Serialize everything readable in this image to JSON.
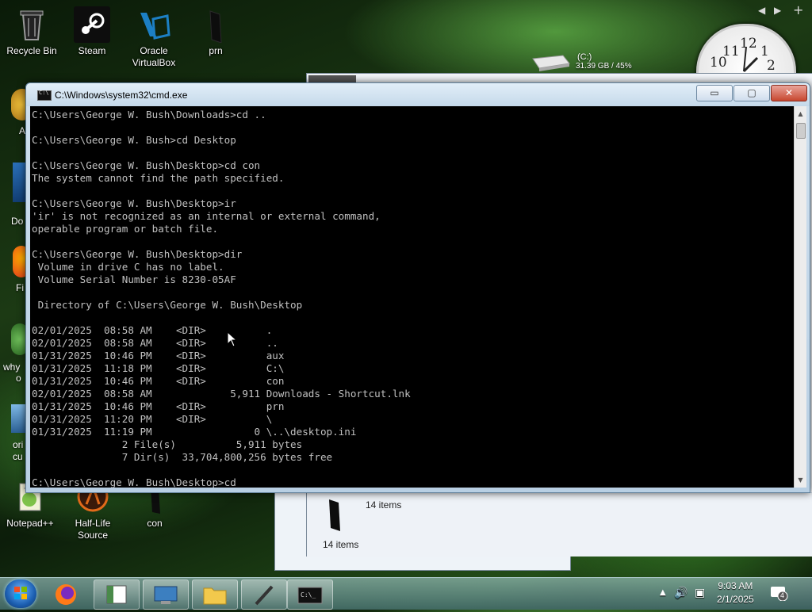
{
  "desktop": {
    "icons": [
      {
        "label": "Recycle Bin",
        "icon": "recycle-bin-icon"
      },
      {
        "label": "Steam",
        "icon": "steam-icon"
      },
      {
        "label": "Oracle\nVirtualBox",
        "icon": "virtualbox-icon"
      },
      {
        "label": "prn",
        "icon": "folder-icon"
      },
      {
        "label": "Notepad++",
        "icon": "notepadpp-icon"
      },
      {
        "label": "Half-Life\nSource",
        "icon": "halflife-icon"
      },
      {
        "label": "con",
        "icon": "folder-icon"
      }
    ],
    "partial_labels": [
      "A",
      "Do",
      "Fi",
      "why",
      "o",
      "ori",
      "cu"
    ]
  },
  "drive_gadget": {
    "drive": "(C:)",
    "usage": "31.39 GB / 45%"
  },
  "clock_gadget": {
    "numerals": [
      "11",
      "12",
      "1",
      "10",
      "2"
    ]
  },
  "background_windows": {
    "status_1": "14 items",
    "status_2": "14 items"
  },
  "cmd_window": {
    "title": "C:\\Windows\\system32\\cmd.exe",
    "buttons": {
      "minimize": "▭",
      "maximize": "▢",
      "close": "✕"
    },
    "console_text": "C:\\Users\\George W. Bush\\Downloads>cd ..\n\nC:\\Users\\George W. Bush>cd Desktop\n\nC:\\Users\\George W. Bush\\Desktop>cd con\nThe system cannot find the path specified.\n\nC:\\Users\\George W. Bush\\Desktop>ir\n'ir' is not recognized as an internal or external command,\noperable program or batch file.\n\nC:\\Users\\George W. Bush\\Desktop>dir\n Volume in drive C has no label.\n Volume Serial Number is 8230-05AF\n\n Directory of C:\\Users\\George W. Bush\\Desktop\n\n02/01/2025  08:58 AM    <DIR>          .\n02/01/2025  08:58 AM    <DIR>          ..\n01/31/2025  10:46 PM    <DIR>          aux\n01/31/2025  11:18 PM    <DIR>          C:\\\n01/31/2025  10:46 PM    <DIR>          con\n02/01/2025  08:58 AM             5,911 Downloads - Shortcut.lnk\n01/31/2025  10:46 PM    <DIR>          prn\n01/31/2025  11:20 PM    <DIR>          \\\n01/31/2025  11:19 PM                 0 \\..\\desktop.ini\n               2 File(s)          5,911 bytes\n               7 Dir(s)  33,704,800,256 bytes free\n\nC:\\Users\\George W. Bush\\Desktop>cd"
  },
  "taskbar": {
    "items": [
      "firefox-icon",
      "explorer-window-icon",
      "control-panel-icon",
      "file-explorer-icon",
      "notepad-icon",
      "cmd-icon"
    ],
    "tray": {
      "time": "9:03 AM",
      "date": "2/1/2025",
      "notification_count": "4"
    }
  }
}
